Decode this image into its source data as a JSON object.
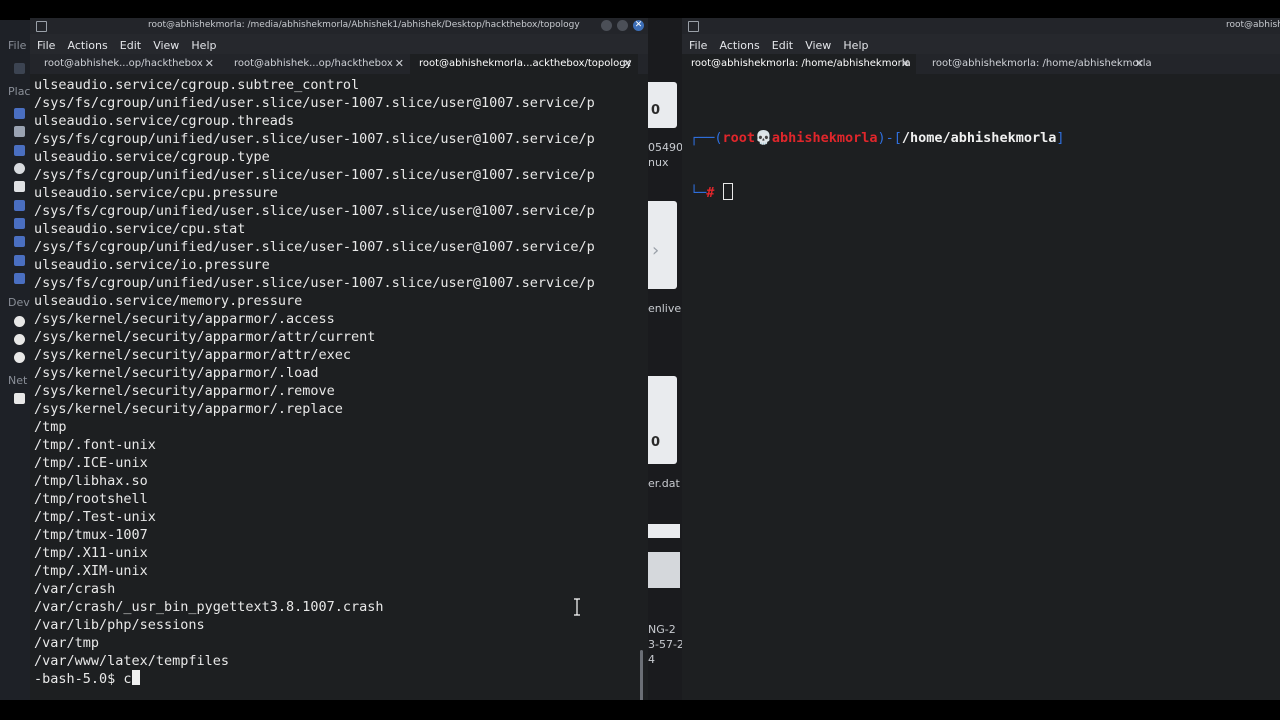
{
  "left_window": {
    "title": "root@abhishekmorla: /media/abhishekmorla/Abhishek1/abhishek/Desktop/hackthebox/topology",
    "menu": [
      "File",
      "Actions",
      "Edit",
      "View",
      "Help"
    ],
    "tabs": [
      {
        "label": "root@abhishek...op/hackthebox"
      },
      {
        "label": "root@abhishek...op/hackthebox"
      },
      {
        "label": "root@abhishekmorla...ackthebox/topology"
      }
    ],
    "output_lines": [
      "ulseaudio.service/cgroup.subtree_control",
      "/sys/fs/cgroup/unified/user.slice/user-1007.slice/user@1007.service/p",
      "ulseaudio.service/cgroup.threads",
      "/sys/fs/cgroup/unified/user.slice/user-1007.slice/user@1007.service/p",
      "ulseaudio.service/cgroup.type",
      "/sys/fs/cgroup/unified/user.slice/user-1007.slice/user@1007.service/p",
      "ulseaudio.service/cpu.pressure",
      "/sys/fs/cgroup/unified/user.slice/user-1007.slice/user@1007.service/p",
      "ulseaudio.service/cpu.stat",
      "/sys/fs/cgroup/unified/user.slice/user-1007.slice/user@1007.service/p",
      "ulseaudio.service/io.pressure",
      "/sys/fs/cgroup/unified/user.slice/user-1007.slice/user@1007.service/p",
      "ulseaudio.service/memory.pressure",
      "/sys/kernel/security/apparmor/.access",
      "/sys/kernel/security/apparmor/attr/current",
      "/sys/kernel/security/apparmor/attr/exec",
      "/sys/kernel/security/apparmor/.load",
      "/sys/kernel/security/apparmor/.remove",
      "/sys/kernel/security/apparmor/.replace",
      "/tmp",
      "/tmp/.font-unix",
      "/tmp/.ICE-unix",
      "/tmp/libhax.so",
      "/tmp/rootshell",
      "/tmp/.Test-unix",
      "/tmp/tmux-1007",
      "/tmp/.X11-unix",
      "/tmp/.XIM-unix",
      "/var/crash",
      "/var/crash/_usr_bin_pygettext3.8.1007.crash",
      "/var/lib/php/sessions",
      "/var/tmp",
      "/var/www/latex/tempfiles"
    ],
    "prompt": "-bash-5.0$ ",
    "typed": "c"
  },
  "right_window": {
    "menu": [
      "File",
      "Actions",
      "Edit",
      "View",
      "Help"
    ],
    "tabs": [
      {
        "label": "root@abhishekmorla: /home/abhishekmorla"
      },
      {
        "label": "root@abhishekmorla: /home/abhishekmorla"
      }
    ],
    "title": "root@abhish",
    "prompt_user": "root",
    "prompt_host": "abhishekmorla",
    "prompt_path": "/home/abhishekmorla",
    "prompt_hash": "#"
  },
  "desktop": {
    "side_labels": [
      "File",
      "Plac",
      "Dev",
      "Net"
    ],
    "mid_texts": [
      "0",
      "05490i",
      "nux",
      "enlive",
      "0",
      "er.dat",
      "NG-2",
      "3-57-2",
      "4"
    ]
  },
  "colors": {
    "bg": "#1d1f21",
    "prompt_blue": "#2f6fdd",
    "prompt_red": "#e0262b"
  }
}
